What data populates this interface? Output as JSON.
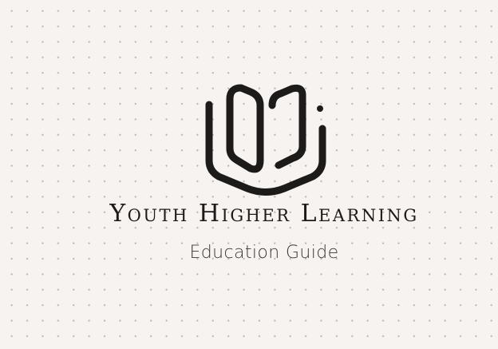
{
  "brand": {
    "title": "Youth Higher Learning",
    "subtitle": "Education Guide",
    "logo_icon": "open-book-icon"
  },
  "colors": {
    "background": "#f6f3f1",
    "dot_grid": "#b9b3ae",
    "ink": "#1d1b1a"
  }
}
